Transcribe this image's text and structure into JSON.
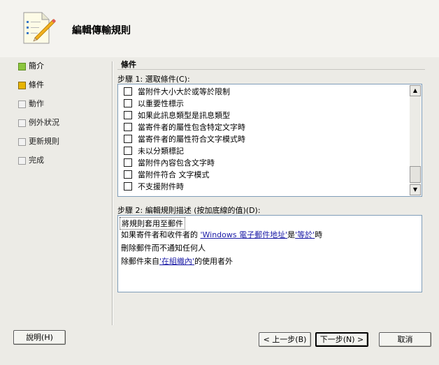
{
  "header": {
    "title": "編輯傳輸規則",
    "icon": "document-pencil-icon"
  },
  "sidebar": {
    "items": [
      {
        "label": "簡介",
        "state": "done"
      },
      {
        "label": "條件",
        "state": "active"
      },
      {
        "label": "動作",
        "state": "pending"
      },
      {
        "label": "例外狀況",
        "state": "pending"
      },
      {
        "label": "更新規則",
        "state": "pending"
      },
      {
        "label": "完成",
        "state": "pending"
      }
    ]
  },
  "main": {
    "section_title": "條件",
    "step1_label": "步驟 1: 選取條件(C):",
    "conditions": [
      {
        "label": "當附件大小大於或等於限制",
        "checked": false
      },
      {
        "label": "以重要性標示",
        "checked": false
      },
      {
        "label": "如果此訊息類型是訊息類型",
        "checked": false
      },
      {
        "label": "當寄件者的屬性包含特定文字時",
        "checked": false
      },
      {
        "label": "當寄件者的屬性符合文字模式時",
        "checked": false
      },
      {
        "label": "未以分類標記",
        "checked": false
      },
      {
        "label": "當附件內容包含文字時",
        "checked": false
      },
      {
        "label": "當附件符合 文字模式",
        "checked": false
      },
      {
        "label": "不支援附件時",
        "checked": false
      }
    ],
    "step2_label": "步驟 2: 編輯規則描述 (按加底線的值)(D):",
    "description": {
      "line1": "將規則套用至郵件",
      "line2_pre": "如果寄件者和收件者的 ",
      "line2_link1": "'Windows 電子郵件地址'",
      "line2_mid": "是",
      "line2_link2": "'等於'",
      "line2_post": "時",
      "line3": "刪除郵件而不通知任何人",
      "line4_pre": "除郵件來自",
      "line4_link": "'在組織內'",
      "line4_post": "的使用者外"
    }
  },
  "buttons": {
    "help": "說明(H)",
    "back": "< 上一步(B)",
    "next": "下一步(N) >",
    "cancel": "取消"
  },
  "colors": {
    "done": "#8cc63e",
    "active": "#e8b400",
    "link": "#1a1aa6",
    "border": "#7f9db9"
  }
}
